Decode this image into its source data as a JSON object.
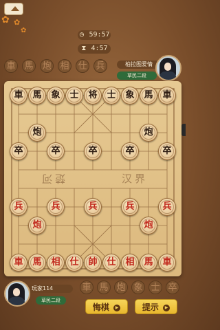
{
  "timers": {
    "total": "59:57",
    "move": "4:57"
  },
  "opponent": {
    "name": "柏拉图爱情",
    "rank": "草民二段"
  },
  "player": {
    "name": "玩家114",
    "rank": "草民二段"
  },
  "captured_top": [
    "車",
    "馬",
    "炮",
    "相",
    "仕",
    "兵"
  ],
  "captured_bottom": [
    "車",
    "馬",
    "炮",
    "象",
    "士",
    "卒"
  ],
  "river": {
    "left": "楚河",
    "right": "汉界"
  },
  "buttons": {
    "regret": "悔棋",
    "hint": "提示"
  },
  "pieces": [
    {
      "t": "車",
      "c": "black",
      "col": 0,
      "row": 0
    },
    {
      "t": "馬",
      "c": "black",
      "col": 1,
      "row": 0
    },
    {
      "t": "象",
      "c": "black",
      "col": 2,
      "row": 0
    },
    {
      "t": "士",
      "c": "black",
      "col": 3,
      "row": 0
    },
    {
      "t": "将",
      "c": "black",
      "col": 4,
      "row": 0
    },
    {
      "t": "士",
      "c": "black",
      "col": 5,
      "row": 0
    },
    {
      "t": "象",
      "c": "black",
      "col": 6,
      "row": 0
    },
    {
      "t": "馬",
      "c": "black",
      "col": 7,
      "row": 0
    },
    {
      "t": "車",
      "c": "black",
      "col": 8,
      "row": 0
    },
    {
      "t": "炮",
      "c": "black",
      "col": 1,
      "row": 2
    },
    {
      "t": "炮",
      "c": "black",
      "col": 7,
      "row": 2
    },
    {
      "t": "卒",
      "c": "black",
      "col": 0,
      "row": 3
    },
    {
      "t": "卒",
      "c": "black",
      "col": 2,
      "row": 3
    },
    {
      "t": "卒",
      "c": "black",
      "col": 4,
      "row": 3
    },
    {
      "t": "卒",
      "c": "black",
      "col": 6,
      "row": 3
    },
    {
      "t": "卒",
      "c": "black",
      "col": 8,
      "row": 3
    },
    {
      "t": "兵",
      "c": "red",
      "col": 0,
      "row": 6
    },
    {
      "t": "兵",
      "c": "red",
      "col": 2,
      "row": 6
    },
    {
      "t": "兵",
      "c": "red",
      "col": 4,
      "row": 6
    },
    {
      "t": "兵",
      "c": "red",
      "col": 6,
      "row": 6
    },
    {
      "t": "兵",
      "c": "red",
      "col": 8,
      "row": 6
    },
    {
      "t": "炮",
      "c": "red",
      "col": 1,
      "row": 7
    },
    {
      "t": "炮",
      "c": "red",
      "col": 7,
      "row": 7
    },
    {
      "t": "車",
      "c": "red",
      "col": 0,
      "row": 9
    },
    {
      "t": "馬",
      "c": "red",
      "col": 1,
      "row": 9
    },
    {
      "t": "相",
      "c": "red",
      "col": 2,
      "row": 9
    },
    {
      "t": "仕",
      "c": "red",
      "col": 3,
      "row": 9
    },
    {
      "t": "帥",
      "c": "red",
      "col": 4,
      "row": 9
    },
    {
      "t": "仕",
      "c": "red",
      "col": 5,
      "row": 9
    },
    {
      "t": "相",
      "c": "red",
      "col": 6,
      "row": 9
    },
    {
      "t": "馬",
      "c": "red",
      "col": 7,
      "row": 9
    },
    {
      "t": "車",
      "c": "red",
      "col": 8,
      "row": 9
    }
  ]
}
